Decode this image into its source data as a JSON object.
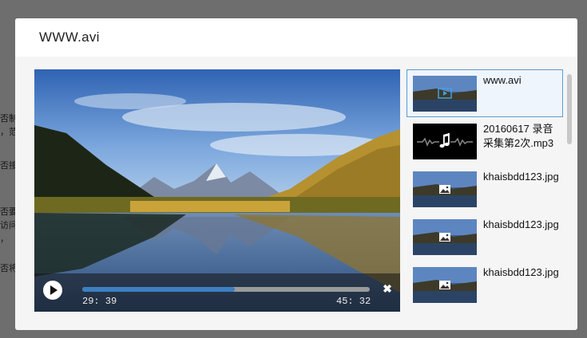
{
  "background": {
    "lines": [
      "否制",
      "，范",
      "否接",
      "否要",
      "访问",
      "，",
      "否将"
    ]
  },
  "modal": {
    "title": "WWW.avi"
  },
  "player": {
    "current_time": "29: 39",
    "total_time": "45: 32",
    "progress": 0.53,
    "play_icon": "play-icon",
    "close_icon": "close-icon"
  },
  "playlist": {
    "items": [
      {
        "label": "www.avi",
        "type": "video",
        "icon": "video-file-icon",
        "active": true
      },
      {
        "label": "20160617 录音采集第2次.mp3",
        "type": "audio",
        "icon": "music-note-icon",
        "active": false
      },
      {
        "label": "khaisbdd123.jpg",
        "type": "image",
        "icon": "image-icon",
        "active": false
      },
      {
        "label": "khaisbdd123.jpg",
        "type": "image",
        "icon": "image-icon",
        "active": false
      },
      {
        "label": "khaisbdd123.jpg",
        "type": "image",
        "icon": "image-icon",
        "active": false
      }
    ]
  }
}
